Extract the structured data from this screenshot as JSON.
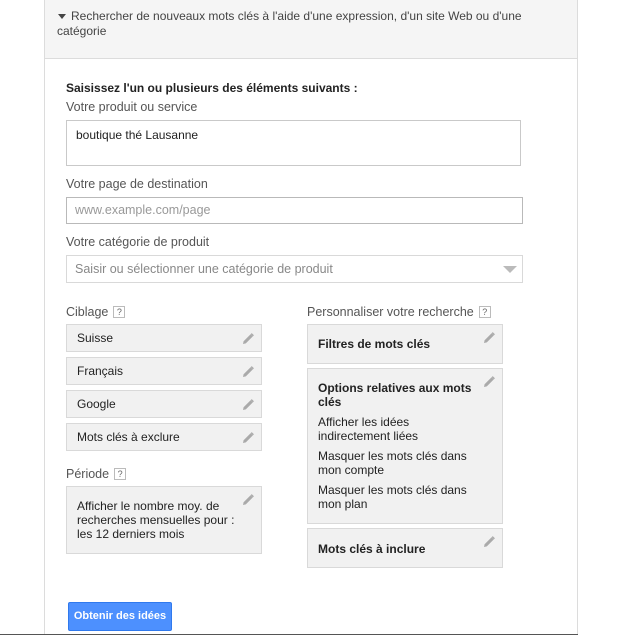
{
  "header": {
    "title": "Rechercher de nouveaux mots clés à l'aide d'une expression, d'un site Web ou d'une catégorie"
  },
  "form": {
    "section_title": "Saisissez l'un ou plusieurs des éléments suivants :",
    "product_label": "Votre produit ou service",
    "product_value": "boutique thé Lausanne",
    "landing_label": "Votre page de destination",
    "landing_placeholder": "www.example.com/page",
    "category_label": "Votre catégorie de produit",
    "category_placeholder": "Saisir ou sélectionner une catégorie de produit"
  },
  "targeting": {
    "label": "Ciblage",
    "items": [
      "Suisse",
      "Français",
      "Google",
      "Mots clés à exclure"
    ]
  },
  "period": {
    "label": "Période",
    "value": "Afficher le nombre moy. de recherches mensuelles pour : les 12 derniers mois"
  },
  "customize": {
    "label": "Personnaliser votre recherche",
    "filters_title": "Filtres de mots clés",
    "options_title": "Options relatives aux mots clés",
    "options": [
      "Afficher les idées indirectement liées",
      "Masquer les mots clés dans mon compte",
      "Masquer les mots clés dans mon plan"
    ],
    "include_title": "Mots clés à inclure"
  },
  "help_glyph": "?",
  "submit_label": "Obtenir des idées",
  "icons": {
    "edit": "pencil-icon",
    "help": "question-mark-icon",
    "collapse": "caret-down-icon",
    "dropdown": "dropdown-arrow-icon"
  },
  "colors": {
    "primary_button": "#4d90fe",
    "panel_header_bg": "#f5f5f5",
    "chip_bg": "#f1f1f1"
  }
}
